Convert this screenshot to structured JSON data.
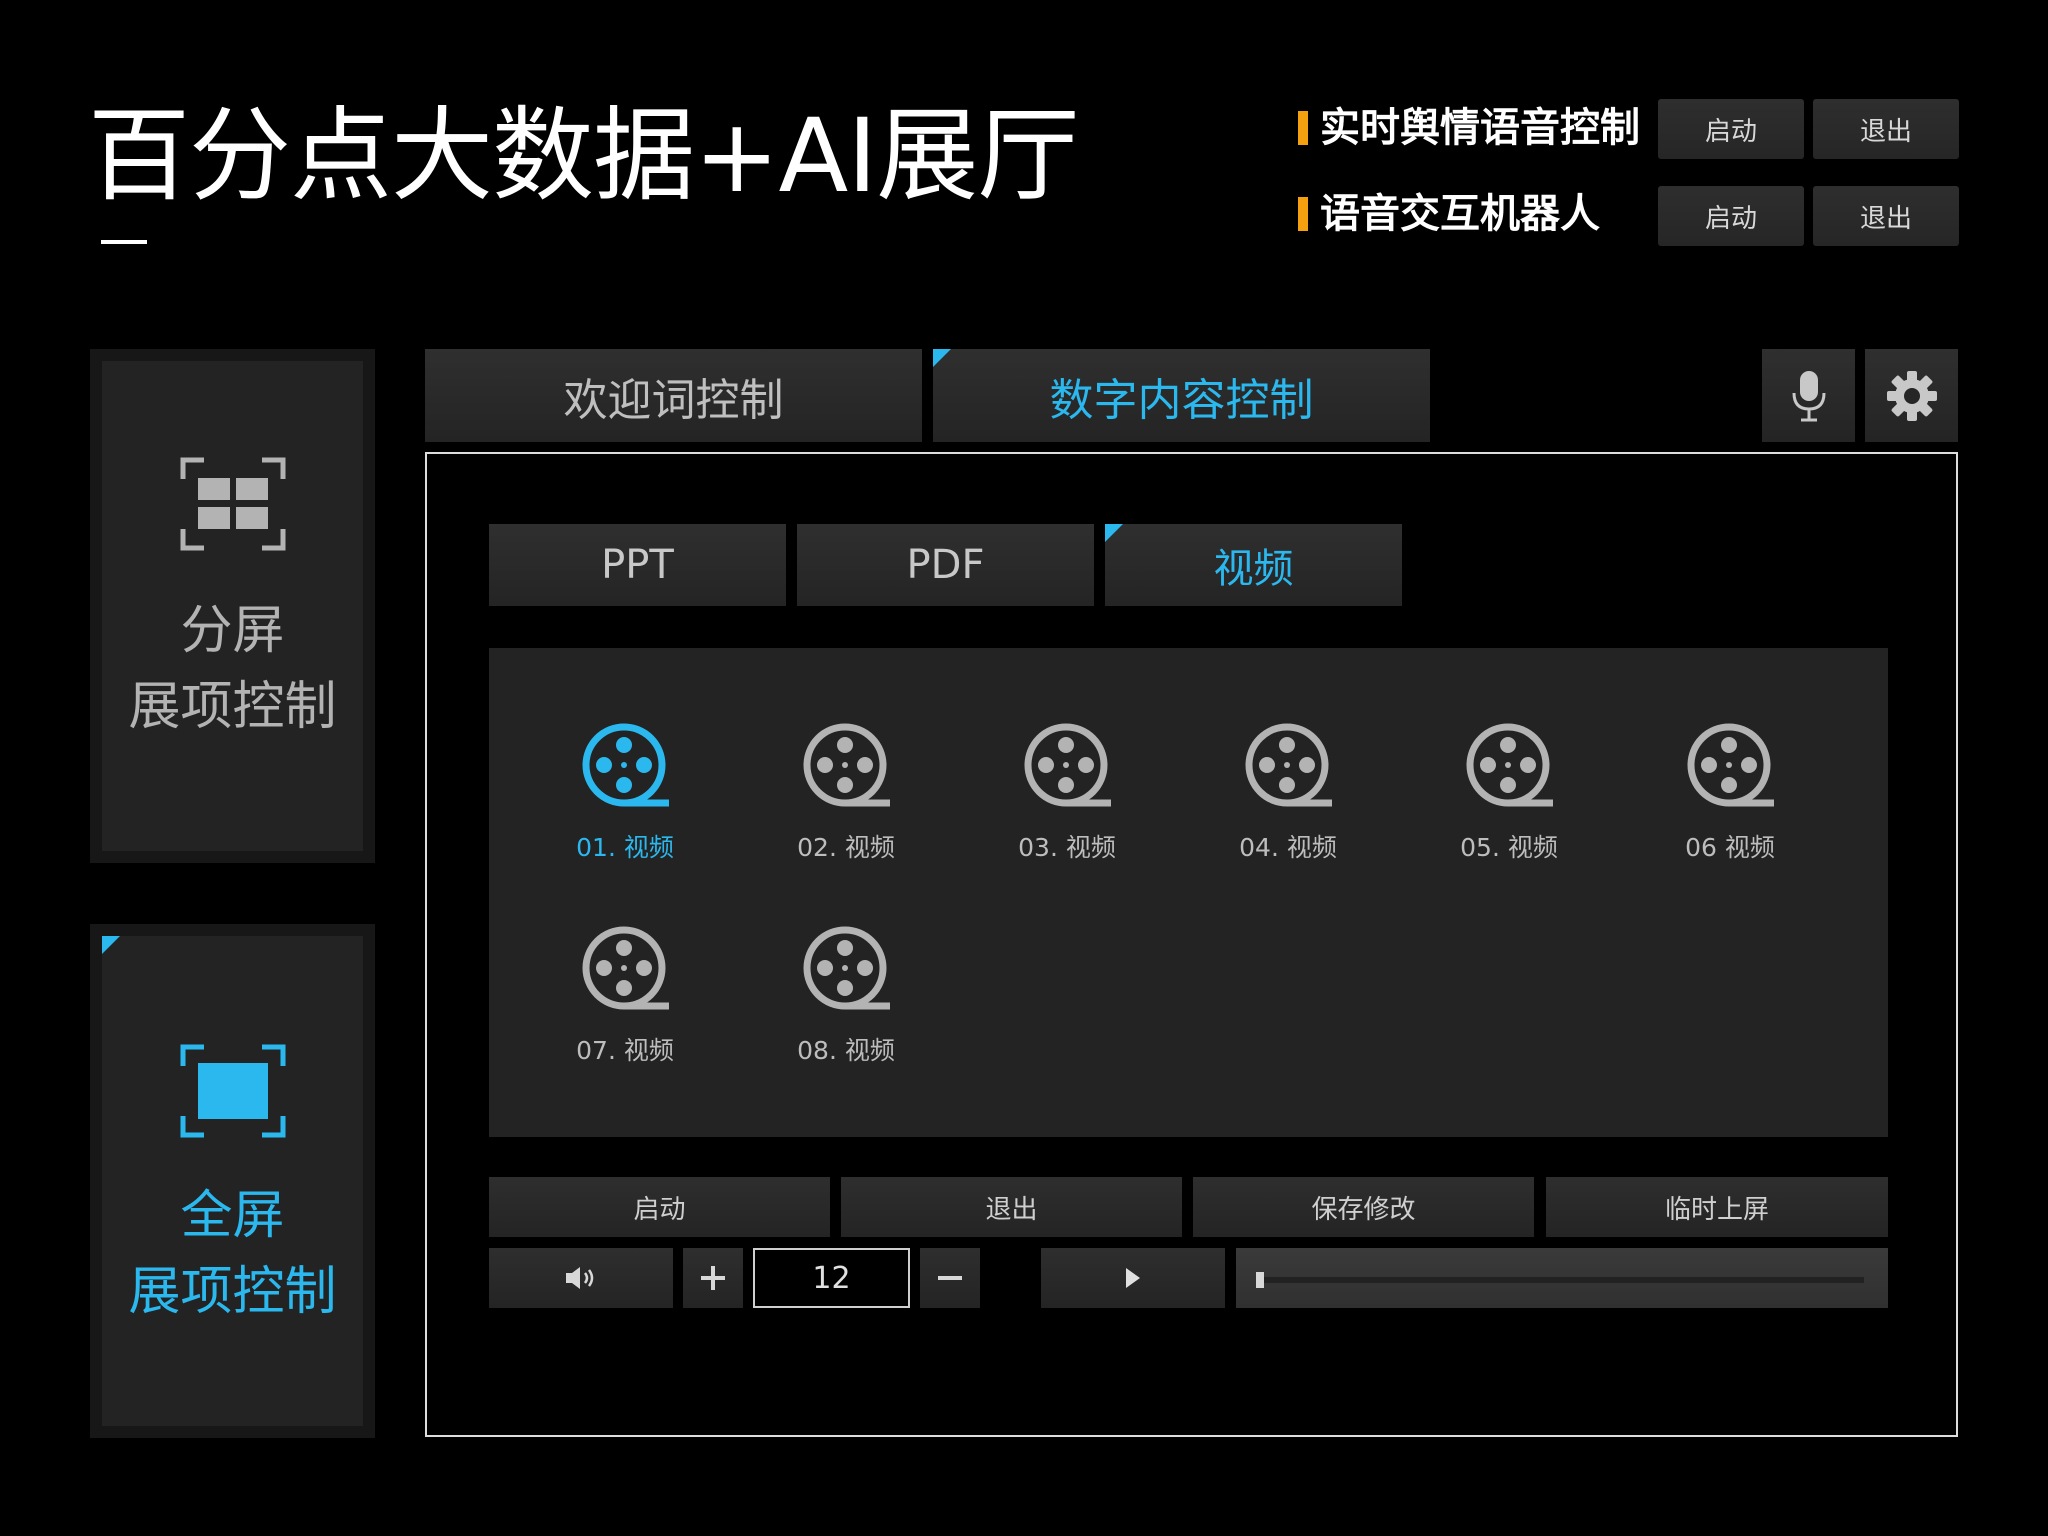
{
  "header": {
    "title": "百分点大数据+AI展厅",
    "voice_controls": [
      {
        "label": "实时舆情语音控制",
        "start": "启动",
        "exit": "退出"
      },
      {
        "label": "语音交互机器人",
        "start": "启动",
        "exit": "退出"
      }
    ]
  },
  "sidebar": {
    "split": {
      "line1": "分屏",
      "line2": "展项控制",
      "icon": "split-screen-icon"
    },
    "full": {
      "line1": "全屏",
      "line2": "展项控制",
      "icon": "fullscreen-icon"
    }
  },
  "tabs": {
    "welcome": "欢迎词控制",
    "digital": "数字内容控制",
    "mic_icon": "microphone-icon",
    "settings_icon": "gear-icon"
  },
  "subtabs": {
    "ppt": "PPT",
    "pdf": "PDF",
    "video": "视频"
  },
  "videos": [
    "01. 视频",
    "02. 视频",
    "03. 视频",
    "04. 视频",
    "05. 视频",
    "06 视频",
    "07. 视频",
    "08. 视频"
  ],
  "controls": {
    "start": "启动",
    "exit": "退出",
    "save": "保存修改",
    "temp_screen": "临时上屏",
    "volume_value": "12",
    "progress": 0
  },
  "colors": {
    "accent": "#2bb8ee",
    "orange": "#f5a00f",
    "inactive_icon": "#b3b3b3"
  }
}
